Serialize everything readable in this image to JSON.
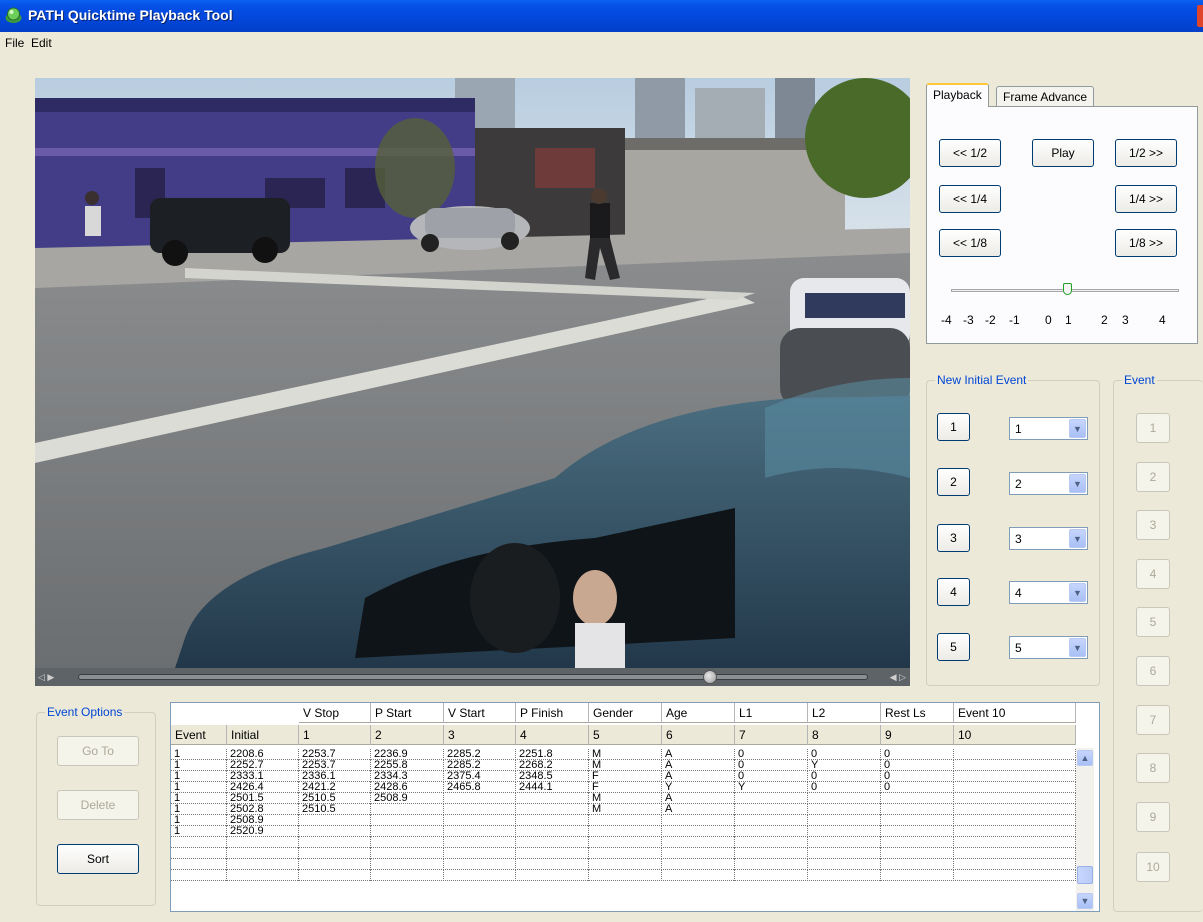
{
  "window": {
    "title": "PATH Quicktime Playback Tool"
  },
  "menu": [
    "File",
    "Edit"
  ],
  "tabs": [
    "Playback",
    "Frame Advance"
  ],
  "playback": {
    "back_half": "<< 1/2",
    "play": "Play",
    "fwd_half": "1/2 >>",
    "back_quarter": "<< 1/4",
    "fwd_quarter": "1/4 >>",
    "back_eighth": "<< 1/8",
    "fwd_eighth": "1/8 >>",
    "speed_ticks": [
      "-4",
      "-3",
      "-2",
      "-1",
      "0",
      "1",
      "2",
      "3",
      "4"
    ],
    "speed_value": 0
  },
  "video": {
    "scrub_position": 0.8
  },
  "new_initial_event": {
    "title": "New Initial Event",
    "buttons": [
      "1",
      "2",
      "3",
      "4",
      "5"
    ],
    "combos": [
      "1",
      "2",
      "3",
      "4",
      "5"
    ]
  },
  "event_group": {
    "title": "Event",
    "buttons": [
      "1",
      "2",
      "3",
      "4",
      "5",
      "6",
      "7",
      "8",
      "9",
      "10"
    ]
  },
  "event_options": {
    "title": "Event Options",
    "goto": "Go To",
    "delete": "Delete",
    "sort": "Sort"
  },
  "table": {
    "header_top": [
      "",
      "",
      "V Stop",
      "P Start",
      "V Start",
      "P Finish",
      "Gender",
      "Age",
      "L1",
      "L2",
      "Rest Ls",
      "Event 10"
    ],
    "header_bottom": [
      "Event",
      "Initial",
      "1",
      "2",
      "3",
      "4",
      "5",
      "6",
      "7",
      "8",
      "9",
      "10"
    ],
    "rows": [
      [
        "1",
        "2208.6",
        "2253.7",
        "2236.9",
        "2285.2",
        "2251.8",
        "M",
        "A",
        "0",
        "0",
        "0",
        ""
      ],
      [
        "1",
        "2252.7",
        "2253.7",
        "2255.8",
        "2285.2",
        "2268.2",
        "M",
        "A",
        "0",
        "Y",
        "0",
        ""
      ],
      [
        "1",
        "2333.1",
        "2336.1",
        "2334.3",
        "2375.4",
        "2348.5",
        "F",
        "A",
        "0",
        "0",
        "0",
        ""
      ],
      [
        "1",
        "2426.4",
        "2421.2",
        "2428.6",
        "2465.8",
        "2444.1",
        "F",
        "Y",
        "Y",
        "0",
        "0",
        ""
      ],
      [
        "1",
        "2501.5",
        "2510.5",
        "2508.9",
        "",
        "",
        "M",
        "A",
        "",
        "",
        "",
        ""
      ],
      [
        "1",
        "2502.8",
        "2510.5",
        "",
        "",
        "",
        "M",
        "A",
        "",
        "",
        "",
        ""
      ],
      [
        "1",
        "2508.9",
        "",
        "",
        "",
        "",
        "",
        "",
        "",
        "",
        "",
        ""
      ],
      [
        "1",
        "2520.9",
        "",
        "",
        "",
        "",
        "",
        "",
        "",
        "",
        "",
        ""
      ],
      [
        "",
        "",
        "",
        "",
        "",
        "",
        "",
        "",
        "",
        "",
        "",
        ""
      ],
      [
        "",
        "",
        "",
        "",
        "",
        "",
        "",
        "",
        "",
        "",
        "",
        ""
      ],
      [
        "",
        "",
        "",
        "",
        "",
        "",
        "",
        "",
        "",
        "",
        "",
        ""
      ],
      [
        "",
        "",
        "",
        "",
        "",
        "",
        "",
        "",
        "",
        "",
        "",
        ""
      ]
    ]
  },
  "colors": {
    "titlebar": "#0346d9",
    "window_bg": "#ece9d8",
    "group_title": "#0046d5",
    "button_border": "#003c74"
  }
}
